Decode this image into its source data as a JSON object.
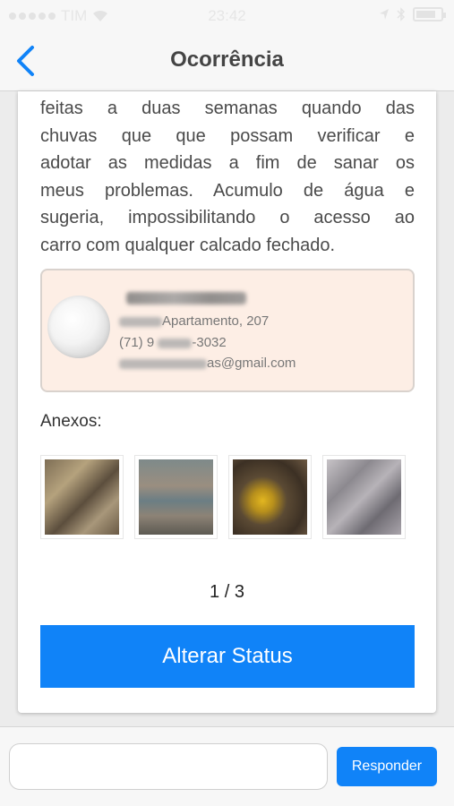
{
  "status_bar": {
    "carrier": "TIM",
    "time": "23:42"
  },
  "nav": {
    "title": "Ocorrência",
    "back_icon": "chevron-left-icon"
  },
  "description": {
    "lines": [
      "feitas a duas semanas quando das",
      "chuvas que que possam verificar e",
      "adotar as medidas a fim de sanar os",
      "meus problemas. Acumulo de água e",
      "sugeria, impossibilitando o acesso ao",
      "carro com qualquer calcado fechado."
    ]
  },
  "contact": {
    "address_visible": "Apartamento, 207",
    "phone_prefix": "(71) 9",
    "phone_suffix": "-3032",
    "email_visible": "as@gmail.com"
  },
  "attachments": {
    "label": "Anexos:",
    "items": [
      "photo-1",
      "photo-2",
      "photo-3",
      "photo-4"
    ]
  },
  "pager": {
    "text": "1 / 3"
  },
  "actions": {
    "change_status": "Alterar Status"
  },
  "reply": {
    "placeholder": "",
    "button": "Responder"
  },
  "colors": {
    "accent": "#1083f8",
    "contact_bg": "#fdeee5"
  }
}
